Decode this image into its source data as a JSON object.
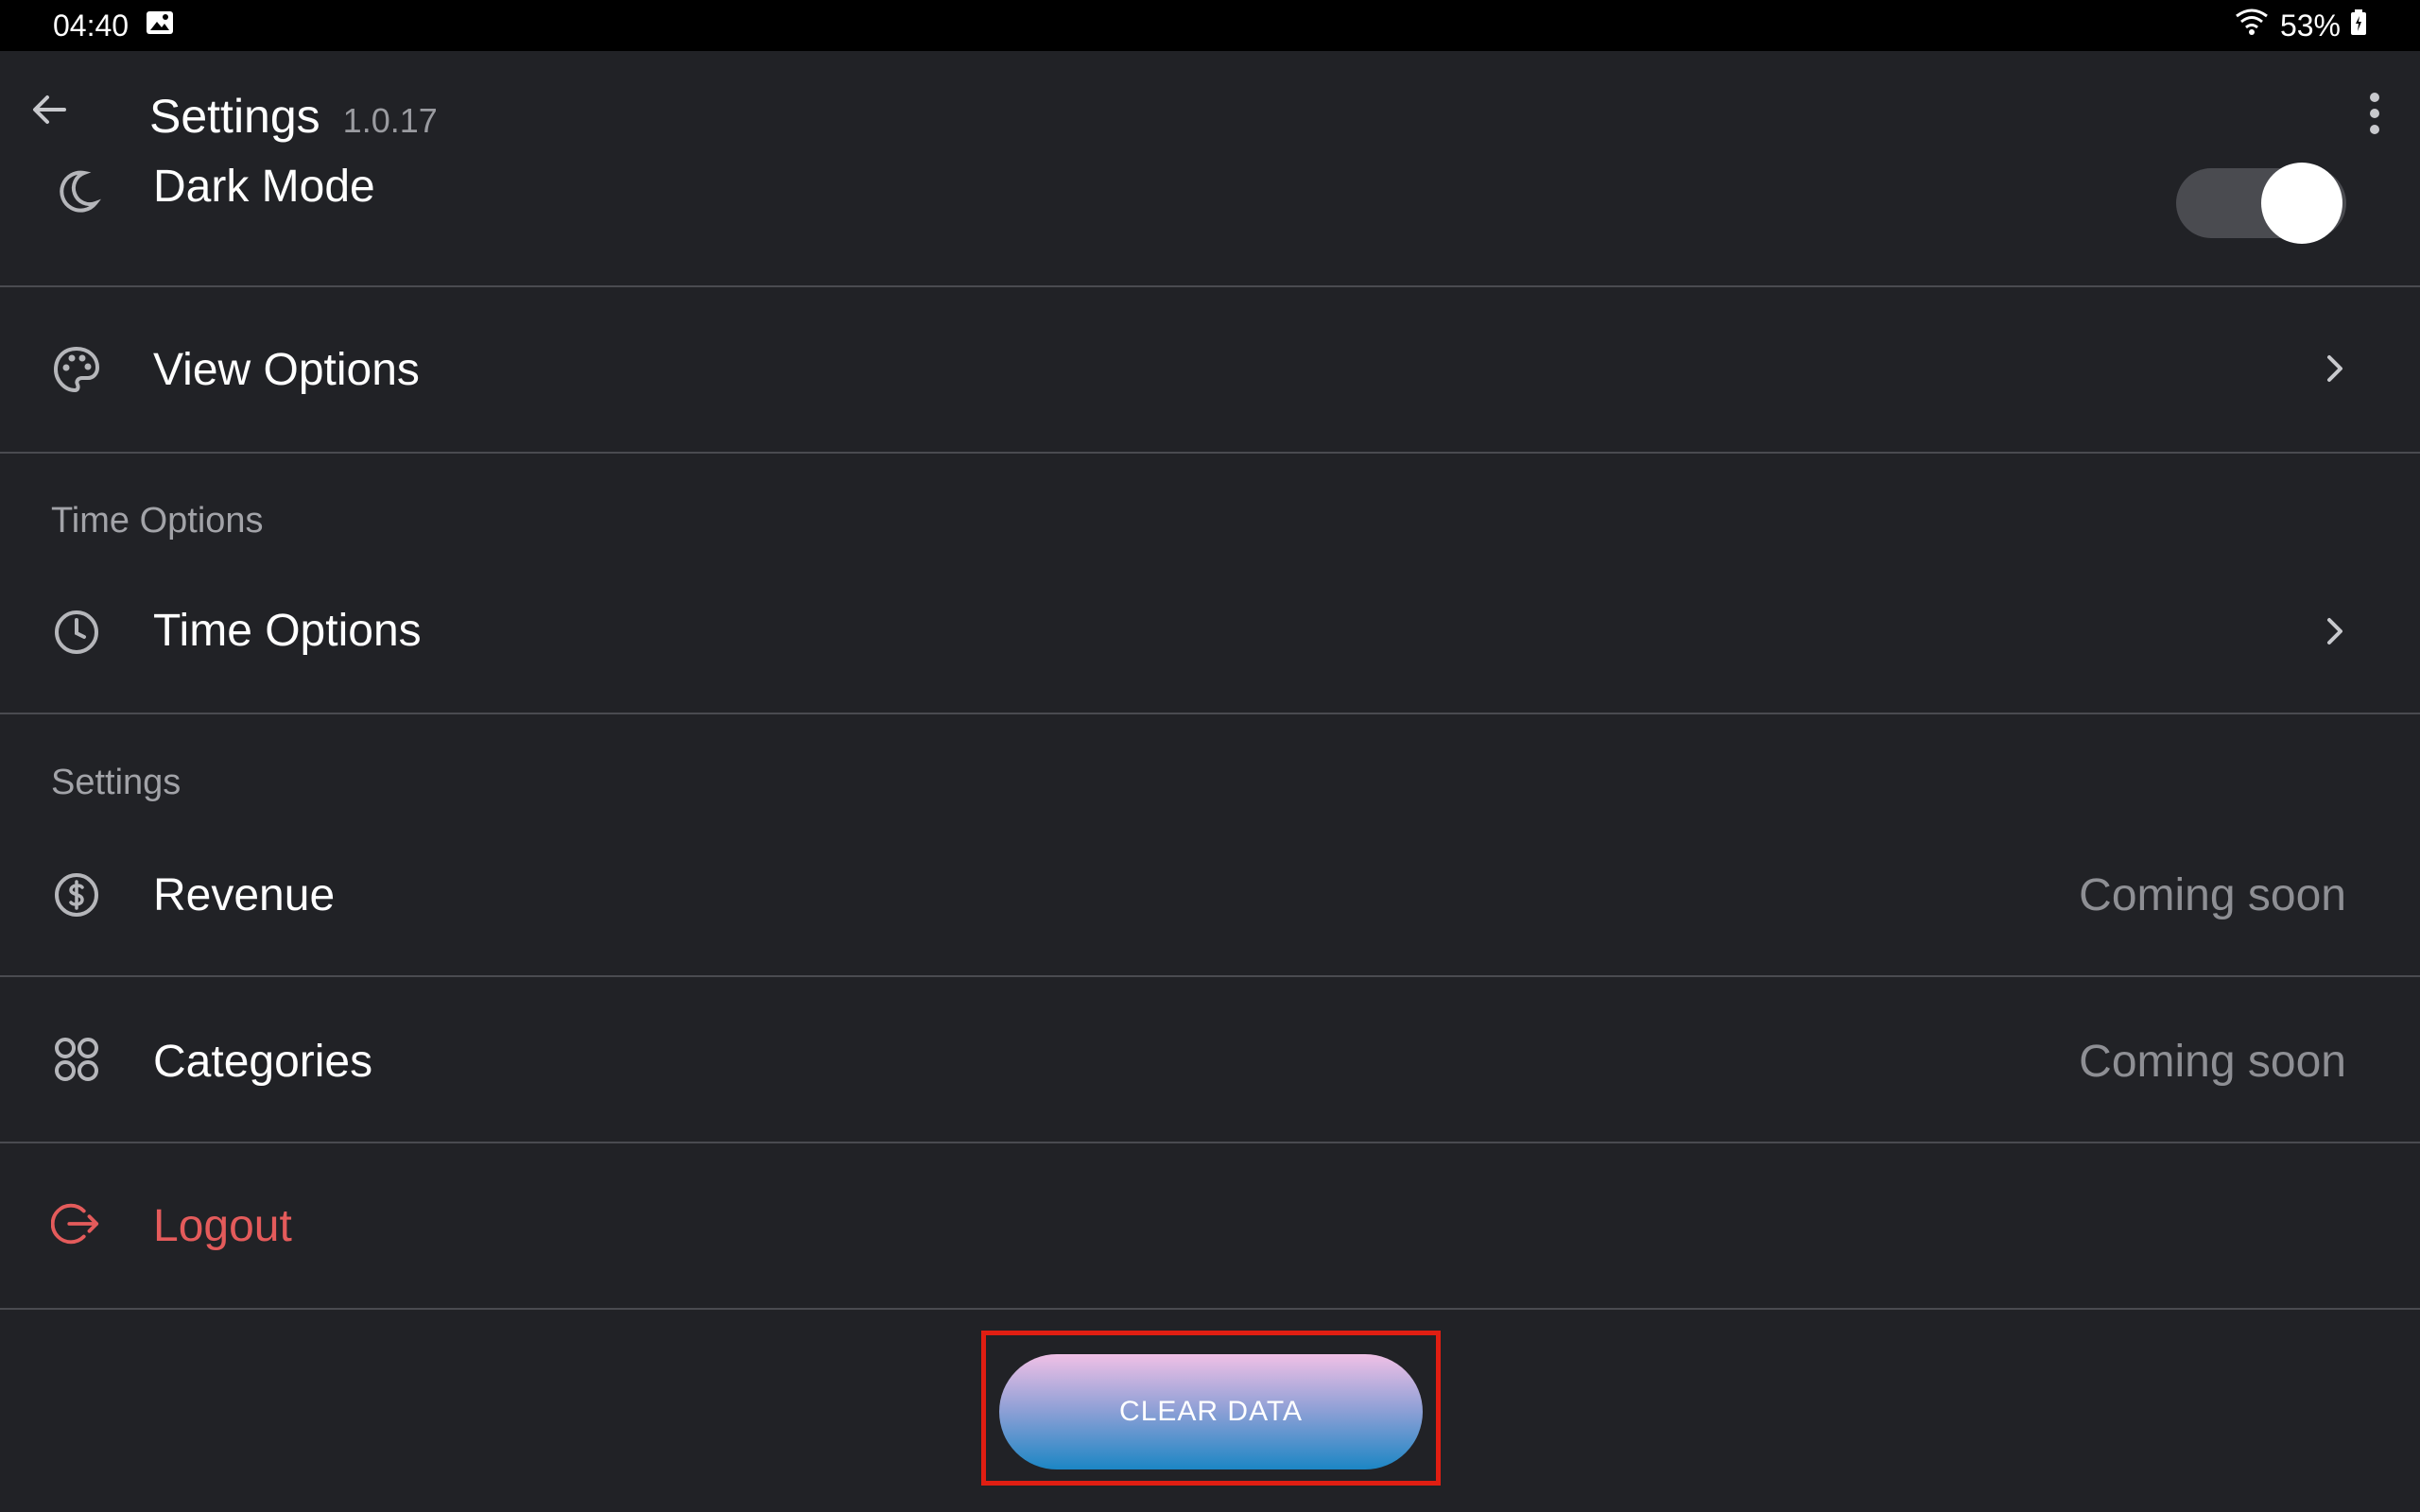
{
  "status_bar": {
    "time": "04:40",
    "battery": "53%"
  },
  "app_bar": {
    "title": "Settings",
    "version": "1.0.17"
  },
  "rows": {
    "dark_mode": {
      "label": "Dark Mode",
      "toggle_on": true
    },
    "view_options": {
      "label": "View Options"
    },
    "time_section_header": "Time Options",
    "time_options": {
      "label": "Time Options"
    },
    "settings_section_header": "Settings",
    "revenue": {
      "label": "Revenue",
      "status": "Coming soon"
    },
    "categories": {
      "label": "Categories",
      "status": "Coming soon"
    },
    "logout": {
      "label": "Logout"
    }
  },
  "actions": {
    "clear_data_label": "CLEAR DATA"
  },
  "colors": {
    "background": "#212226",
    "status_bar": "#000000",
    "divider": "#4a4b50",
    "logout": "#e45b5b",
    "highlight_box": "#e01e12",
    "clear_gradient_top": "#f0c0e6",
    "clear_gradient_bottom": "#1c86c4"
  },
  "icons": {
    "back": "arrow-left-icon",
    "menu": "more-vertical-icon",
    "dark_mode": "moon-icon",
    "view_options": "palette-icon",
    "time_options": "clock-icon",
    "revenue": "dollar-circle-icon",
    "categories": "grid-circles-icon",
    "logout": "logout-icon"
  }
}
